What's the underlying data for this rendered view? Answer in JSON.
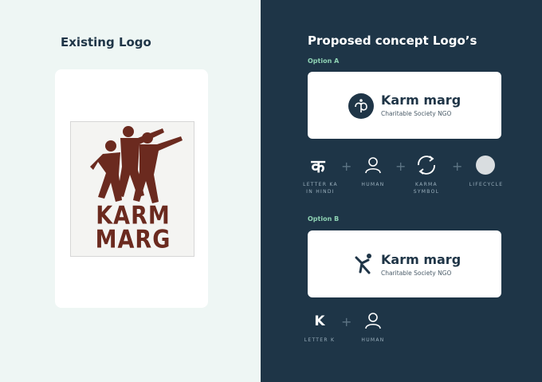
{
  "left": {
    "title": "Existing Logo",
    "old_logo_line1": "KARM",
    "old_logo_line2": "MARG"
  },
  "right": {
    "title": "Proposed concept Logo’s",
    "option_a": {
      "label": "Option A",
      "brand": "Karm marg",
      "tagline": "Charitable Society NGO",
      "elements": [
        {
          "glyph": "क",
          "caption": "LETTER KA IN HINDI"
        },
        {
          "icon": "human-icon",
          "caption": "HUMAN"
        },
        {
          "icon": "karma-cycle-icon",
          "caption": "KARMA SYMBOL"
        },
        {
          "icon": "circle-icon",
          "caption": "LIFECYCLE"
        }
      ]
    },
    "option_b": {
      "label": "Option B",
      "brand": "Karm marg",
      "tagline": "Charitable Society NGO",
      "elements": [
        {
          "glyph": "K",
          "caption": "LETTER K"
        },
        {
          "icon": "human-icon",
          "caption": "HUMAN"
        }
      ]
    }
  },
  "colors": {
    "navy": "#1e3547",
    "mint_bg": "#eef6f4",
    "accent_green": "#8fd3b4",
    "old_logo_brown": "#6b2a1f"
  }
}
